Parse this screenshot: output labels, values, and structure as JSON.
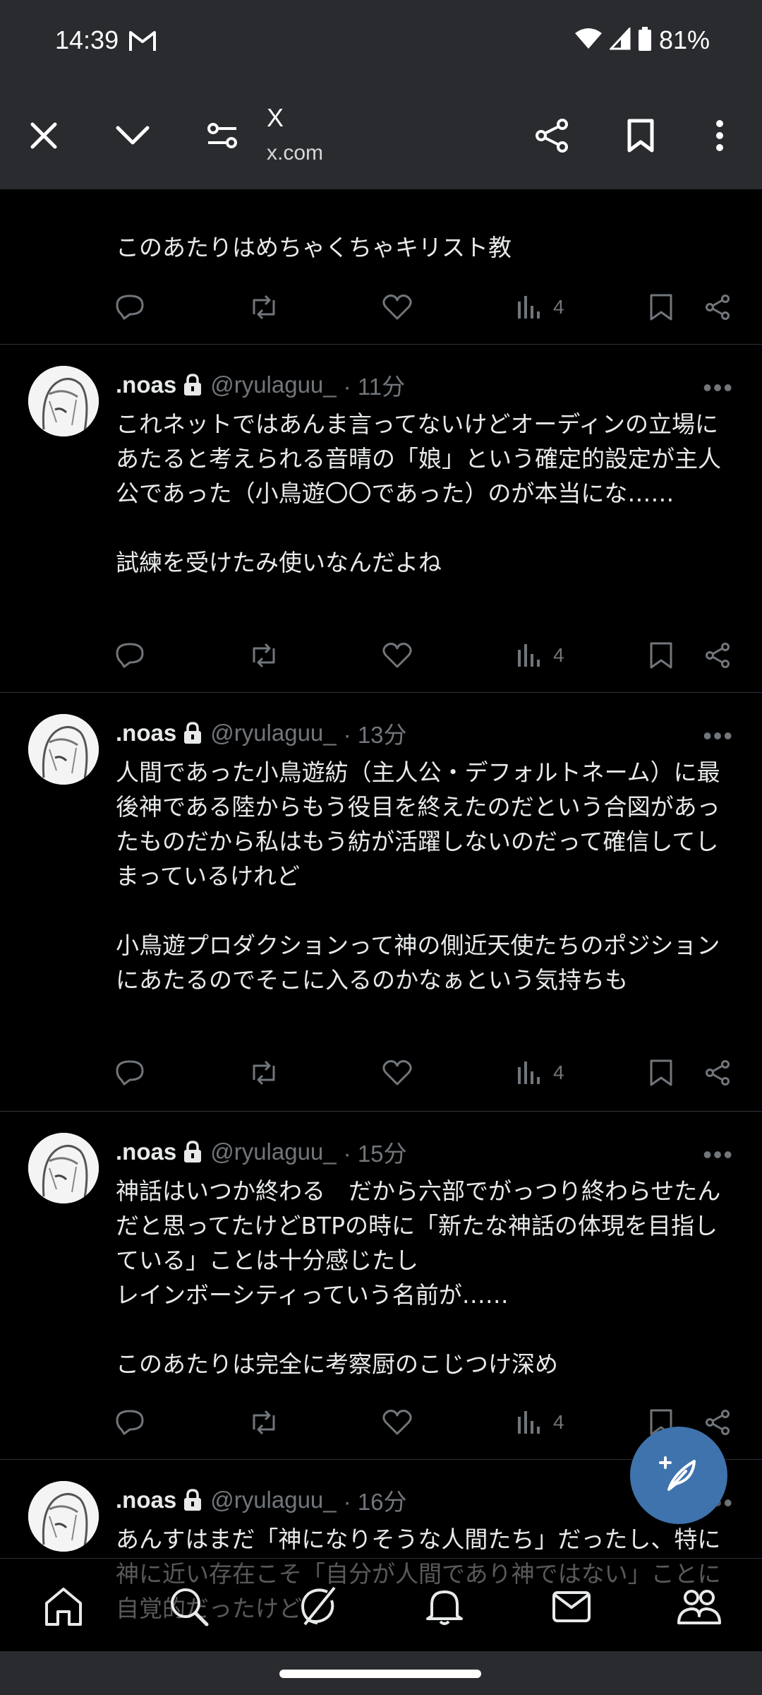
{
  "status_bar": {
    "time": "14:39",
    "battery": "81%"
  },
  "browser": {
    "title": "X",
    "url": "x.com"
  },
  "colors": {
    "background": "#000000",
    "chrome": "#2a2b2f",
    "text": "#e7e9ea",
    "muted": "#71767b",
    "fab": "#3f73ad"
  },
  "tweets": [
    {
      "body": "このあたりはめちゃくちゃキリスト教",
      "views": "4"
    },
    {
      "name": ".noas",
      "handle": "@ryulaguu_",
      "time": "· 11分",
      "body": "これネットではあんま言ってないけどオーディンの立場にあたると考えられる音晴の「娘」という確定的設定が主人公であった（小鳥遊〇〇であった）のが本当にな……\n\n試練を受けたみ使いなんだよね",
      "views": "4"
    },
    {
      "name": ".noas",
      "handle": "@ryulaguu_",
      "time": "· 13分",
      "body": "人間であった小鳥遊紡（主人公・デフォルトネーム）に最後神である陸からもう役目を終えたのだという合図があったものだから私はもう紡が活躍しないのだって確信してしまっているけれど\n\n小鳥遊プロダクションって神の側近天使たちのポジションにあたるのでそこに入るのかなぁという気持ちも",
      "views": "4"
    },
    {
      "name": ".noas",
      "handle": "@ryulaguu_",
      "time": "· 15分",
      "body": "神話はいつか終わる　だから六部でがっつり終わらせたんだと思ってたけどBTPの時に「新たな神話の体現を目指している」ことは十分感じたし\nレインボーシティっていう名前が……\n\nこのあたりは完全に考察厨のこじつけ深め",
      "views": "4"
    },
    {
      "name": ".noas",
      "handle": "@ryulaguu_",
      "time": "· 16分",
      "body": "あんすはまだ「神になりそうな人間たち」だったし、特に神に近い存在こそ「自分が人間であり神ではない」ことに自覚的だったけど"
    }
  ],
  "icons": {
    "status": [
      "gmail-icon",
      "wifi-icon",
      "signal-icon",
      "battery-icon"
    ],
    "browser": [
      "close-icon",
      "chevron-down-icon",
      "site-settings-icon",
      "share-icon",
      "bookmark-icon",
      "more-vert-icon"
    ],
    "tweet_actions": [
      "reply-icon",
      "retweet-icon",
      "like-icon",
      "views-icon",
      "bookmark-icon",
      "share-icon"
    ],
    "nav": [
      "home-icon",
      "search-icon",
      "grok-icon",
      "notifications-icon",
      "messages-icon",
      "communities-icon"
    ],
    "fab": "compose-icon"
  }
}
